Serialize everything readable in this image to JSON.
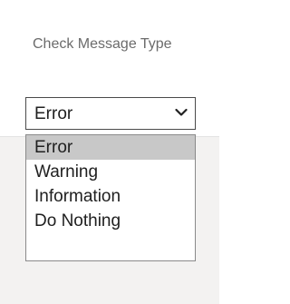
{
  "field": {
    "label": "Check Message Type",
    "selected_value": "Error"
  },
  "dropdown": {
    "options": [
      "Error",
      "Warning",
      "Information",
      "Do Nothing"
    ],
    "highlighted_index": 0
  },
  "icons": {
    "select_chevron": "chevron-down-icon"
  },
  "colors": {
    "label_text": "#6b6b6b",
    "option_highlight": "#c8c8c8",
    "panel_background": "#f3f2f1"
  }
}
